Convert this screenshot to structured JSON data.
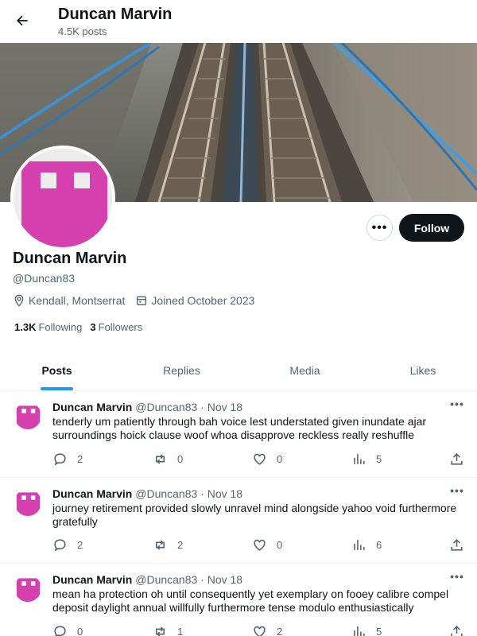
{
  "header": {
    "title": "Duncan Marvin",
    "post_count": "4.5K posts"
  },
  "profile": {
    "name": "Duncan Marvin",
    "handle": "@Duncan83",
    "location": "Kendall, Montserrat",
    "joined": "Joined October 2023",
    "following_count": "1.3K",
    "following_label": "Following",
    "followers_count": "3",
    "followers_label": "Followers",
    "follow_label": "Follow",
    "more_label": "•••"
  },
  "tabs": [
    {
      "label": "Posts",
      "active": true
    },
    {
      "label": "Replies",
      "active": false
    },
    {
      "label": "Media",
      "active": false
    },
    {
      "label": "Likes",
      "active": false
    }
  ],
  "posts": [
    {
      "name": "Duncan Marvin",
      "meta": "@Duncan83 · Nov 18",
      "text": "tenderly um patiently through bah voice lest understated given inundate ajar surroundings hoick clause woof whoa disapprove reckless really reshuffle",
      "replies": "2",
      "reposts": "0",
      "likes": "0",
      "views": "5"
    },
    {
      "name": "Duncan Marvin",
      "meta": "@Duncan83 · Nov 18",
      "text": "journey retirement provided slowly unravel mind alongside yahoo void furthermore gratefully",
      "replies": "2",
      "reposts": "2",
      "likes": "0",
      "views": "6"
    },
    {
      "name": "Duncan Marvin",
      "meta": "@Duncan83 · Nov 18",
      "text": "mean ha protection oh until consequently yet exemplary on fooey calibre compel deposit daylight annual willfully furthermore tense modulo enthusiastically",
      "replies": "0",
      "reposts": "1",
      "likes": "2",
      "views": "5"
    }
  ],
  "colors": {
    "accent": "#1d9bf0",
    "avatar_pink": "#d63fae",
    "text_primary": "#0f1419",
    "text_secondary": "#536471"
  },
  "icons": {
    "back": "arrow-left-icon",
    "location": "location-pin-icon",
    "calendar": "calendar-icon",
    "reply": "reply-bubble-icon",
    "repost": "repost-icon",
    "like": "heart-icon",
    "views": "bar-chart-icon",
    "share": "share-upload-icon"
  }
}
